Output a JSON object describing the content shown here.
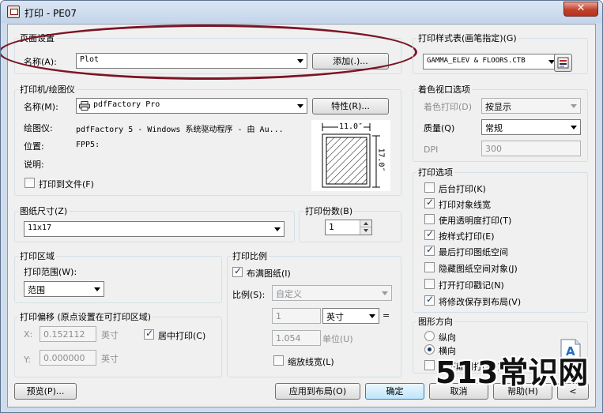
{
  "window": {
    "title": "打印 - PE07",
    "close_glyph": "✕"
  },
  "page_setup": {
    "title": "页面设置",
    "name_label": "名称(A):",
    "name_value": "Plot",
    "add_button": "添加(.)..."
  },
  "printer": {
    "title": "打印机/绘图仪",
    "name_label": "名称(M):",
    "name_value": "pdfFactory Pro",
    "properties_button": "特性(R)...",
    "plotter_label": "绘图仪:",
    "plotter_value": "pdfFactory 5 - Windows 系统驱动程序 - 由 Au...",
    "location_label": "位置:",
    "location_value": "FPP5:",
    "description_label": "说明:",
    "plot_to_file_label": "打印到文件(F)",
    "plot_to_file_checked": false,
    "preview_width": "11.0″",
    "preview_height": "17.0″"
  },
  "paper_size": {
    "title": "图纸尺寸(Z)",
    "value": "11x17"
  },
  "copies": {
    "title": "打印份数(B)",
    "value": "1"
  },
  "plot_area": {
    "title": "打印区域",
    "what_label": "打印范围(W):",
    "what_value": "范围"
  },
  "plot_offset": {
    "title": "打印偏移 (原点设置在可打印区域)",
    "x_label": "X:",
    "x_value": "0.152112",
    "x_unit": "英寸",
    "y_label": "Y:",
    "y_value": "0.000000",
    "y_unit": "英寸",
    "center_label": "居中打印(C)",
    "center_checked": true
  },
  "plot_scale": {
    "title": "打印比例",
    "fit_label": "布满图纸(I)",
    "fit_checked": true,
    "scale_label": "比例(S):",
    "scale_value": "自定义",
    "num_value": "1",
    "unit_value": "英寸",
    "equals": "=",
    "den_value": "1.054",
    "den_unit": "单位(U)",
    "lineweights_label": "缩放线宽(L)",
    "lineweights_checked": false
  },
  "plot_style": {
    "title": "打印样式表(画笔指定)(G)",
    "value": "GAMMA_ELEV & FLOORS.CTB"
  },
  "shaded": {
    "title": "着色视口选项",
    "shade_label": "着色打印(D)",
    "shade_value": "按显示",
    "quality_label": "质量(Q)",
    "quality_value": "常规",
    "dpi_label": "DPI",
    "dpi_value": "300"
  },
  "plot_options": {
    "title": "打印选项",
    "items": [
      {
        "label": "后台打印(K)",
        "checked": false
      },
      {
        "label": "打印对象线宽",
        "checked": true
      },
      {
        "label": "使用透明度打印(T)",
        "checked": false
      },
      {
        "label": "按样式打印(E)",
        "checked": true
      },
      {
        "label": "最后打印图纸空间",
        "checked": true
      },
      {
        "label": "隐藏图纸空间对象(J)",
        "checked": false
      },
      {
        "label": "打开打印戳记(N)",
        "checked": false
      },
      {
        "label": "将修改保存到布局(V)",
        "checked": true
      }
    ]
  },
  "orientation": {
    "title": "图形方向",
    "portrait_label": "纵向",
    "landscape_label": "横向",
    "selected": "landscape",
    "upside_down_label": "上下颠倒打印(-)",
    "upside_down_checked": false,
    "landscape_glyph": "A"
  },
  "footer": {
    "preview_button": "预览(P)...",
    "apply_button": "应用到布局(O)",
    "ok_button": "确定",
    "cancel_button": "取消",
    "help_button": "帮助(H)"
  },
  "watermark": {
    "text": "513常识网"
  },
  "colors": {
    "highlight_ellipse": "#7d1424",
    "window_frame": "#cfdcec",
    "close_button": "#c1412b"
  }
}
